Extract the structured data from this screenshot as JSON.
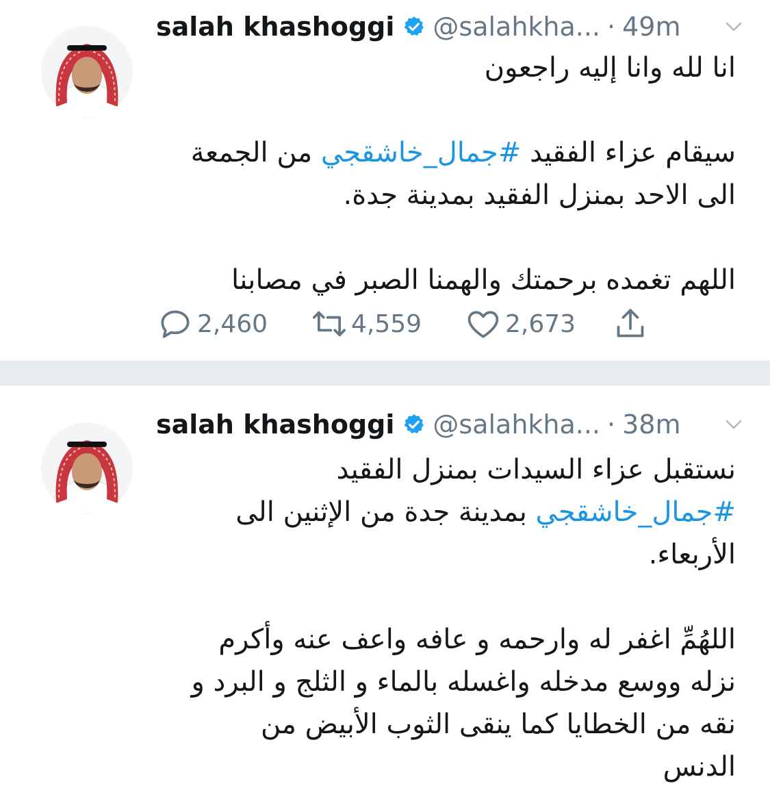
{
  "colors": {
    "name": "#14171a",
    "meta": "#657786",
    "hashtag": "#1b95e0",
    "verified": "#1da1f2",
    "separator": "#e6ecf0"
  },
  "tweets": [
    {
      "author_name": "salah khashoggi",
      "handle": "@salahkha...",
      "separator_dot": "·",
      "time": "49m",
      "verified_icon": "verified-badge-icon",
      "lines": [
        {
          "text": "انا لله وانا إليه راجعون"
        },
        {
          "pre": "سيقام عزاء الفقيد ",
          "hashtag": "#جمال_خاشقجي",
          "post": " من الجمعة"
        },
        {
          "text": "الى الاحد بمنزل الفقيد بمدينة جدة."
        },
        {
          "text": "اللهم تغمده برحمتك والهمنا الصبر في مصابنا"
        }
      ],
      "stats": {
        "replies": "2,460",
        "retweets": "4,559",
        "likes": "2,673"
      }
    },
    {
      "author_name": "salah khashoggi",
      "handle": "@salahkha...",
      "separator_dot": "·",
      "time": "38m",
      "verified_icon": "verified-badge-icon",
      "lines": [
        {
          "text": "نستقبل عزاء السيدات بمنزل الفقيد"
        },
        {
          "hashtag": "#جمال_خاشقجي",
          "post": " بمدينة جدة من الإثنين الى"
        },
        {
          "text": "الأربعاء."
        },
        {
          "text": "اللهُمِّ اغفر له وارحمه و عافه واعف عنه وأكرم"
        },
        {
          "text": "نزله ووسع مدخله واغسله بالماء و الثلج و البرد و"
        },
        {
          "text": "نقه من الخطايا كما ينقى الثوب الأبيض من"
        },
        {
          "text": "الدنس"
        }
      ]
    }
  ]
}
